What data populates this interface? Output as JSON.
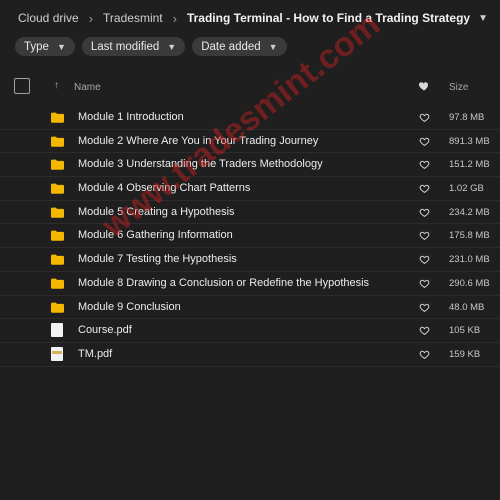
{
  "breadcrumb": {
    "items": [
      "Cloud drive",
      "Tradesmint"
    ],
    "current": "Trading Terminal - How to Find a Trading Strategy"
  },
  "filters": [
    {
      "label": "Type"
    },
    {
      "label": "Last modified"
    },
    {
      "label": "Date added"
    }
  ],
  "columns": {
    "name": "Name",
    "size": "Size"
  },
  "files": [
    {
      "name": "Module 1 Introduction",
      "size": "97.8 MB",
      "kind": "folder"
    },
    {
      "name": "Module 2 Where Are You in Your Trading Journey",
      "size": "891.3 MB",
      "kind": "folder"
    },
    {
      "name": "Module 3 Understanding the Traders Methodology",
      "size": "151.2 MB",
      "kind": "folder"
    },
    {
      "name": "Module 4 Observing Chart Patterns",
      "size": "1.02 GB",
      "kind": "folder"
    },
    {
      "name": "Module 5 Creating a Hypothesis",
      "size": "234.2 MB",
      "kind": "folder"
    },
    {
      "name": "Module 6 Gathering Information",
      "size": "175.8 MB",
      "kind": "folder"
    },
    {
      "name": "Module 7 Testing the Hypothesis",
      "size": "231.0 MB",
      "kind": "folder"
    },
    {
      "name": "Module 8 Drawing a Conclusion or Redefine the Hypothesis",
      "size": "290.6 MB",
      "kind": "folder"
    },
    {
      "name": "Module 9 Conclusion",
      "size": "48.0 MB",
      "kind": "folder"
    },
    {
      "name": "Course.pdf",
      "size": "105 KB",
      "kind": "pdf"
    },
    {
      "name": "TM.pdf",
      "size": "159 KB",
      "kind": "pdf-thumb"
    }
  ],
  "watermark": "www.tradesmint.com",
  "colors": {
    "folder": "#f5b800",
    "watermark": "#dc1e1e",
    "background": "#1f1f1f"
  }
}
